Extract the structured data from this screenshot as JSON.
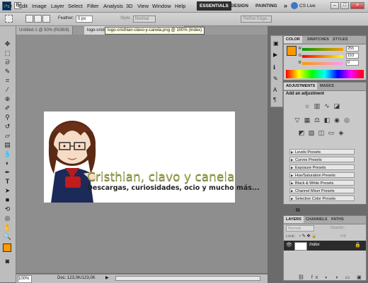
{
  "app": {
    "logo": "Ps",
    "zoom": "100%"
  },
  "menu": [
    "File",
    "Edit",
    "Image",
    "Layer",
    "Select",
    "Filter",
    "Analysis",
    "3D",
    "View",
    "Window",
    "Help"
  ],
  "workspaces": {
    "essentials": "ESSENTIALS",
    "design": "DESIGN",
    "painting": "PAINTING",
    "more": "»",
    "cslive": "CS Live"
  },
  "options": {
    "feather_label": "Feather:",
    "feather_value": "0 px",
    "style_label": "Style:",
    "style_value": "Normal",
    "refine": "Refine Edge..."
  },
  "tabs": [
    {
      "label": "Untitled-1 @ 50% (RGB/8)"
    },
    {
      "label": "logo-cristhian-clavo-y-canela.png @ 100% (Index)"
    }
  ],
  "tooltip": "logo-cristhian-clavo-y-canela.png @ 100% (Index)",
  "artwork": {
    "title": "Cristhian, clavo y canela",
    "tagline": "Descargas, curiosidades, ocio y mucho más..."
  },
  "status": {
    "zoom": "100%",
    "doc": "Doc: 123,0K/123,0K"
  },
  "color_panel": {
    "tabs": [
      "COLOR",
      "SWATCHES",
      "STYLES"
    ],
    "channels": [
      {
        "label": "R",
        "value": "255",
        "level": 1.0
      },
      {
        "label": "G",
        "value": "153",
        "level": 0.6
      },
      {
        "label": "B",
        "value": "0",
        "level": 0.0
      }
    ],
    "foreground": "#ff9900"
  },
  "adjustments": {
    "tabs": [
      "ADJUSTMENTS",
      "MASKS"
    ],
    "heading": "Add an adjustment",
    "presets": [
      "Levels Presets",
      "Curves Presets",
      "Exposure Presets",
      "Hue/Saturation Presets",
      "Black & White Presets",
      "Channel Mixer Presets",
      "Selective Color Presets"
    ]
  },
  "layers": {
    "tabs": [
      "LAYERS",
      "CHANNELS",
      "PATHS"
    ],
    "blend_mode": "Normal",
    "opacity_label": "Opacity:",
    "lock_label": "Lock:",
    "fill_label": "Fill:",
    "layer_name": "Index"
  }
}
